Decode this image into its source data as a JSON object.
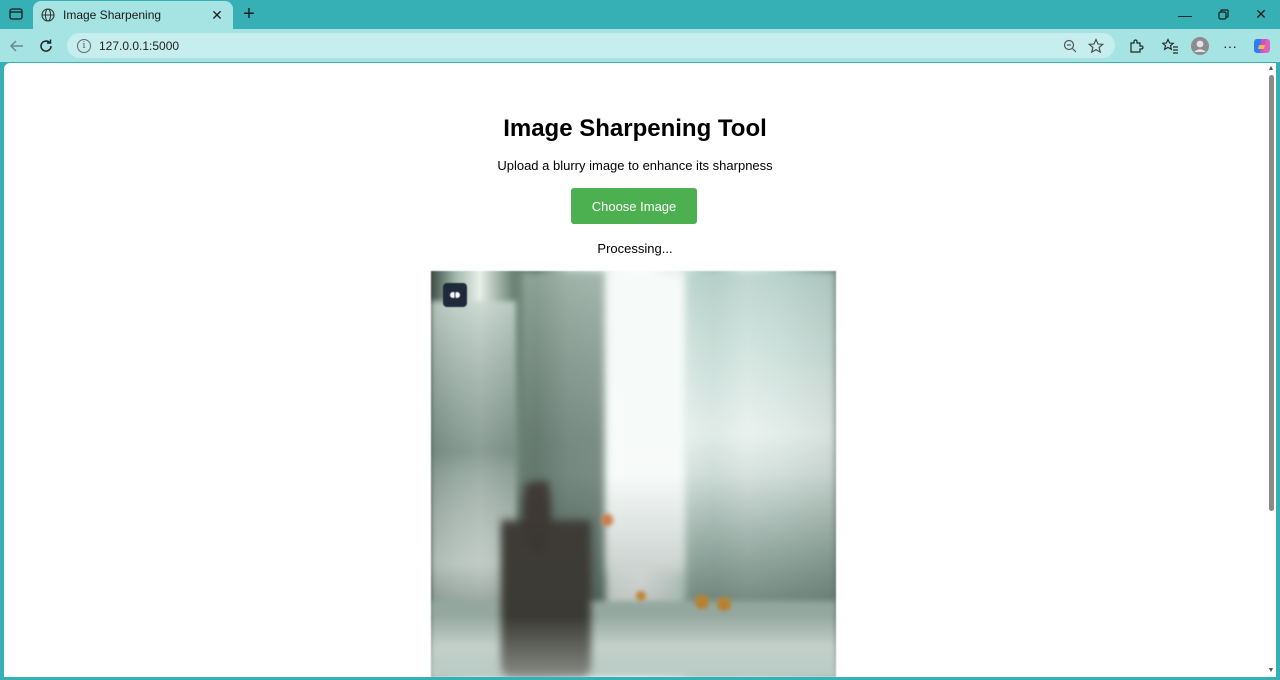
{
  "browser": {
    "tab": {
      "title": "Image Sharpening",
      "icon": "globe-icon"
    },
    "address": {
      "url": "127.0.0.1:5000"
    }
  },
  "page": {
    "title": "Image Sharpening Tool",
    "subtitle": "Upload a blurry image to enhance its sharpness",
    "choose_button": "Choose Image",
    "status": "Processing...",
    "accent_color": "#4caf50",
    "image_badge_icon": "extension-badge-icon"
  },
  "colors": {
    "titlebar": "#36b0b4",
    "toolbar": "#a6e4e4",
    "button": "#4caf50"
  }
}
